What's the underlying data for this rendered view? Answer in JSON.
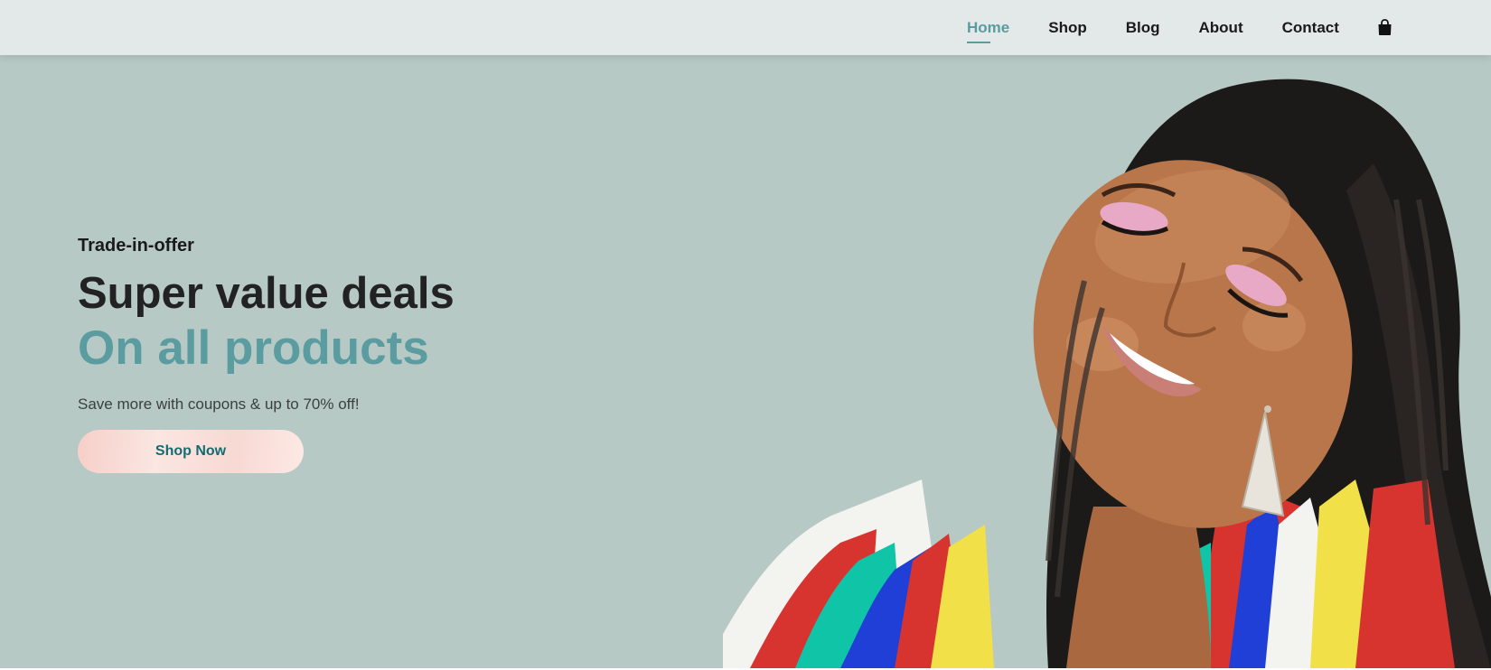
{
  "nav": {
    "items": [
      {
        "label": "Home",
        "active": true
      },
      {
        "label": "Shop",
        "active": false
      },
      {
        "label": "Blog",
        "active": false
      },
      {
        "label": "About",
        "active": false
      },
      {
        "label": "Contact",
        "active": false
      }
    ],
    "cart_icon": "shopping-bag-icon"
  },
  "hero": {
    "eyebrow": "Trade-in-offer",
    "headline": "Super value deals",
    "headline_accent": "On all products",
    "subtext": "Save more with coupons & up to 70% off!",
    "cta_label": "Shop Now",
    "image": "smiling-woman-with-braids-portrait"
  },
  "colors": {
    "accent": "#5a9c9f",
    "hero_background": "#b7c9c5",
    "header_background": "#e3e8e8",
    "cta_text": "#126d73",
    "cta_background": "#f8d9d3"
  }
}
